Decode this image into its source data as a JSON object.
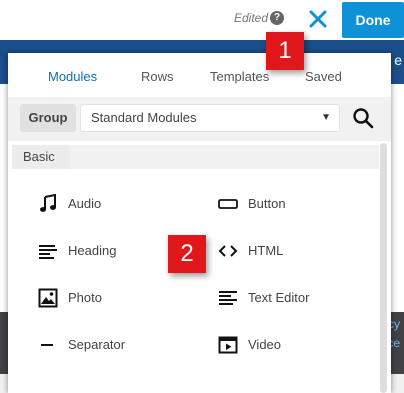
{
  "topbar": {
    "edited_label": "Edited",
    "help_glyph": "?",
    "done_label": "Done",
    "accent_color": "#0e91d6"
  },
  "background": {
    "partial_heading": "e",
    "partial_link_1": "icy",
    "partial_link_2": "ce"
  },
  "panel": {
    "tabs": [
      {
        "label": "Modules",
        "active": true
      },
      {
        "label": "Rows",
        "active": false
      },
      {
        "label": "Templates",
        "active": false
      },
      {
        "label": "Saved",
        "active": false
      }
    ],
    "group": {
      "label": "Group",
      "selected": "Standard Modules"
    },
    "section_title": "Basic",
    "modules": [
      {
        "label": "Audio",
        "icon": "music-note-icon"
      },
      {
        "label": "Button",
        "icon": "button-icon"
      },
      {
        "label": "Heading",
        "icon": "heading-icon"
      },
      {
        "label": "HTML",
        "icon": "code-icon"
      },
      {
        "label": "Photo",
        "icon": "photo-icon"
      },
      {
        "label": "Text Editor",
        "icon": "text-editor-icon"
      },
      {
        "label": "Separator",
        "icon": "separator-icon"
      },
      {
        "label": "Video",
        "icon": "video-icon"
      }
    ]
  },
  "callouts": [
    {
      "number": "1",
      "color": "#e0181b"
    },
    {
      "number": "2",
      "color": "#e0181b"
    }
  ]
}
